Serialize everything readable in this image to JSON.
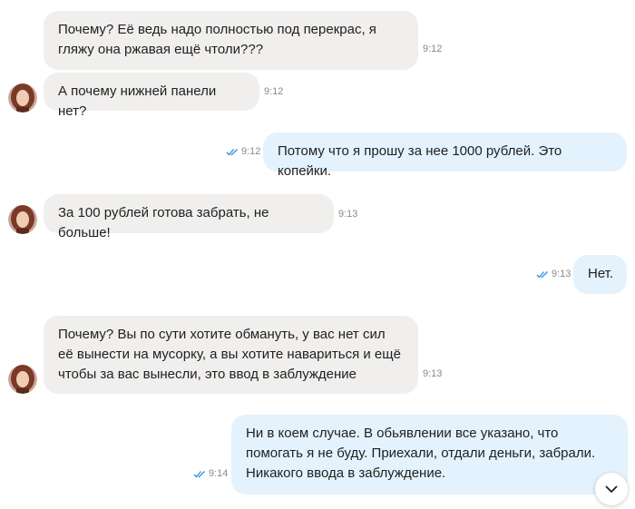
{
  "colors": {
    "incoming_bubble": "#f0efee",
    "outgoing_bubble": "#e3f2fd",
    "read_ticks": "#2f8fe0",
    "timestamp": "#8a8a8a"
  },
  "messages": [
    {
      "direction": "incoming",
      "text": "Почему? Её ведь надо полностью под перекрас, я гляжу она ржавая ещё чтоли???",
      "time": "9:12",
      "avatar": false
    },
    {
      "direction": "incoming",
      "text": "А почему нижней панели нет?",
      "time": "9:12",
      "avatar": true
    },
    {
      "direction": "outgoing",
      "text": "Потому что я прошу за нее 1000 рублей. Это копейки.",
      "time": "9:12",
      "read": true
    },
    {
      "direction": "incoming",
      "text": "За 100 рублей готова забрать, не больше!",
      "time": "9:13",
      "avatar": true
    },
    {
      "direction": "outgoing",
      "text": "Нет.",
      "time": "9:13",
      "read": true
    },
    {
      "direction": "incoming",
      "text": "Почему? Вы по сути хотите обмануть, у вас нет сил её вынести на мусорку, а вы хотите навариться и ещё чтобы за вас вынесли, это ввод в заблуждение",
      "time": "9:13",
      "avatar": true
    },
    {
      "direction": "outgoing",
      "text": "Ни в коем случае. В обьявлении все указано, что помогать я не буду. Приехали, отдали деньги, забрали. Никакого ввода в заблуждение.",
      "time": "9:14",
      "read": true
    }
  ],
  "scroll_button": {
    "icon": "chevron-down-icon"
  }
}
